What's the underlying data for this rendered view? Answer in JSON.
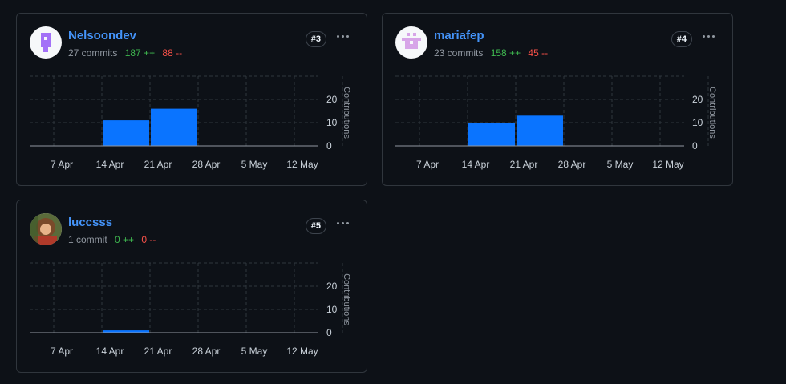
{
  "contributors": [
    {
      "name": "Nelsoondev",
      "commits": "27 commits",
      "additions": "187 ++",
      "deletions": "88 --",
      "rank": "#3",
      "avatar_icon": "purple-pixel-identicon",
      "avatar_color": "#a371f7"
    },
    {
      "name": "mariafep",
      "commits": "23 commits",
      "additions": "158 ++",
      "deletions": "45 --",
      "rank": "#4",
      "avatar_icon": "pink-pixel-identicon",
      "avatar_color": "#d7a5e8"
    },
    {
      "name": "luccsss",
      "commits": "1 commit",
      "additions": "0 ++",
      "deletions": "0 --",
      "rank": "#5",
      "avatar_icon": "photo-avatar",
      "avatar_color": "#6b4a2e"
    }
  ],
  "chart_data": [
    {
      "type": "bar",
      "categories": [
        "7 Apr",
        "14 Apr",
        "21 Apr",
        "28 Apr",
        "5 May",
        "12 May"
      ],
      "values": [
        0,
        11,
        16,
        0,
        0,
        0
      ],
      "ylabel": "Contributions",
      "yticks": [
        "0",
        "10",
        "20"
      ],
      "ylim": [
        0,
        30
      ],
      "color": "#0a74ff"
    },
    {
      "type": "bar",
      "categories": [
        "7 Apr",
        "14 Apr",
        "21 Apr",
        "28 Apr",
        "5 May",
        "12 May"
      ],
      "values": [
        0,
        10,
        13,
        0,
        0,
        0
      ],
      "ylabel": "Contributions",
      "yticks": [
        "0",
        "10",
        "20"
      ],
      "ylim": [
        0,
        30
      ],
      "color": "#0a74ff"
    },
    {
      "type": "bar",
      "categories": [
        "7 Apr",
        "14 Apr",
        "21 Apr",
        "28 Apr",
        "5 May",
        "12 May"
      ],
      "values": [
        0,
        1,
        0,
        0,
        0,
        0
      ],
      "ylabel": "Contributions",
      "yticks": [
        "0",
        "10",
        "20"
      ],
      "ylim": [
        0,
        30
      ],
      "color": "#0a74ff"
    }
  ]
}
